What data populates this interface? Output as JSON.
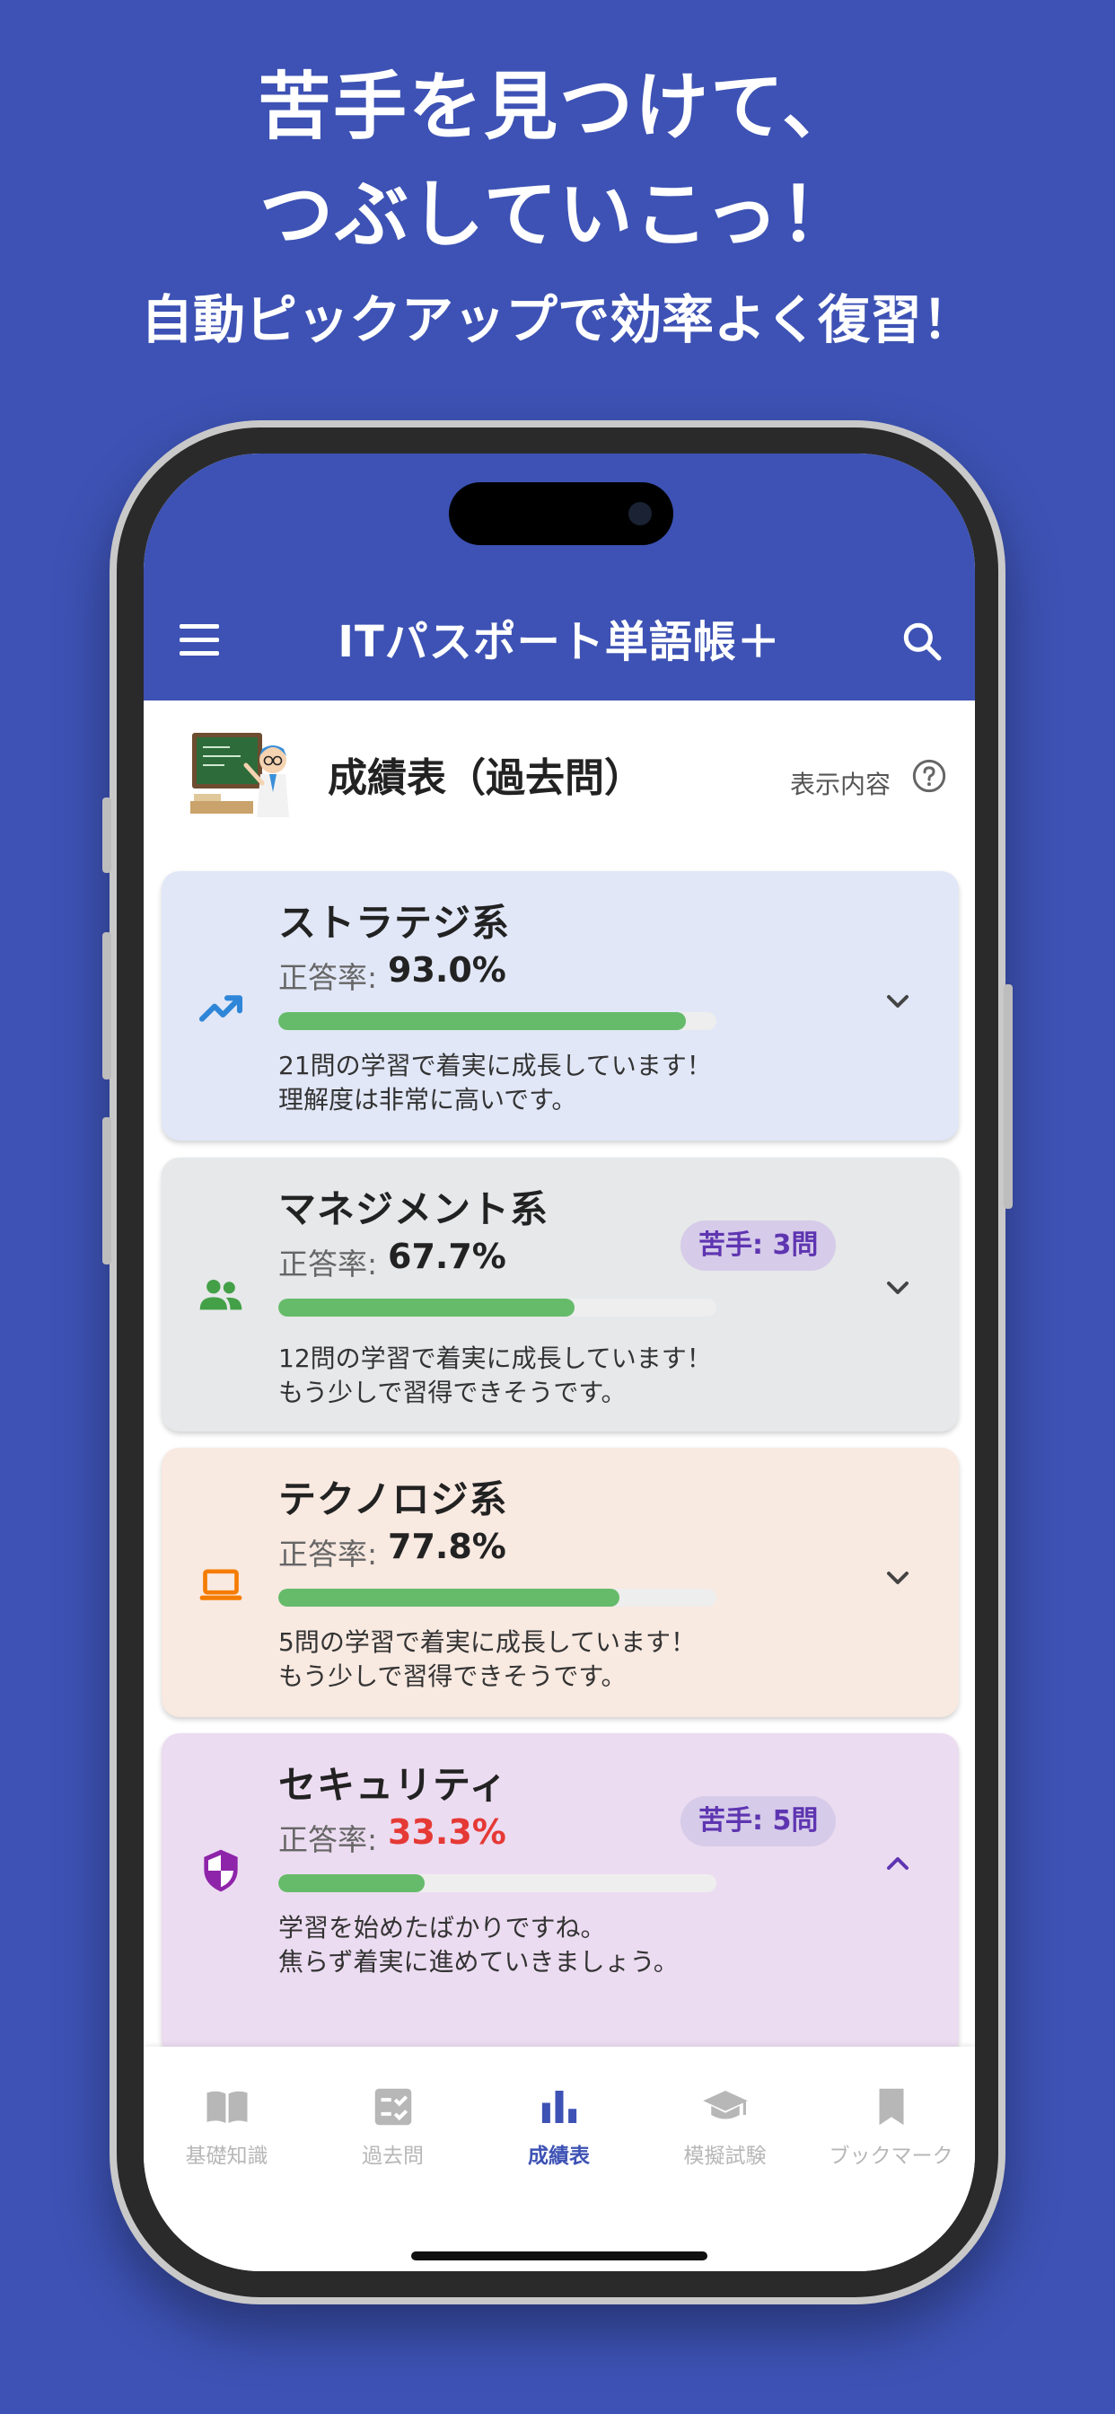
{
  "promo": {
    "line1": "苦手を見つけて、",
    "line2": "つぶしていこっ！",
    "line3": "自動ピックアップで効率よく復習！"
  },
  "app_bar": {
    "title": "ITパスポート単語帳＋"
  },
  "header": {
    "title": "成績表（過去問）",
    "display_label": "表示内容"
  },
  "cards": [
    {
      "name": "ストラテジ系",
      "rate_label": "正答率:",
      "rate": "93.0%",
      "progress": 0.93,
      "weak": "",
      "msg1": "21問の学習で着実に成長しています！",
      "msg2": "理解度は非常に高いです。",
      "icon": "trending-up-icon"
    },
    {
      "name": "マネジメント系",
      "rate_label": "正答率:",
      "rate": "67.7%",
      "progress": 0.677,
      "weak": "苦手: 3問",
      "msg1": "12問の学習で着実に成長しています！",
      "msg2": "もう少しで習得できそうです。",
      "icon": "people-icon"
    },
    {
      "name": "テクノロジ系",
      "rate_label": "正答率:",
      "rate": "77.8%",
      "progress": 0.778,
      "weak": "",
      "msg1": "5問の学習で着実に成長しています！",
      "msg2": "もう少しで習得できそうです。",
      "icon": "laptop-icon"
    },
    {
      "name": "セキュリティ",
      "rate_label": "正答率:",
      "rate": "33.3%",
      "progress": 0.333,
      "weak": "苦手: 5問",
      "msg1": "学習を始めたばかりですね。",
      "msg2": "焦らず着実に進めていきましょう。",
      "icon": "shield-icon"
    }
  ],
  "nav": [
    {
      "label": "基礎知識",
      "icon": "book-icon",
      "active": false
    },
    {
      "label": "過去問",
      "icon": "checklist-icon",
      "active": false
    },
    {
      "label": "成績表",
      "icon": "bar-chart-icon",
      "active": true
    },
    {
      "label": "模擬試験",
      "icon": "graduation-cap-icon",
      "active": false
    },
    {
      "label": "ブックマーク",
      "icon": "bookmark-icon",
      "active": false
    }
  ],
  "colors": {
    "primary": "#3d52b4",
    "card_strategy": "#e1e7f7",
    "card_management": "#e6e8e9",
    "card_technology": "#f8e9e1",
    "card_security": "#ecdcf1",
    "progress": "#66bb6a",
    "low_rate": "#e53935"
  }
}
